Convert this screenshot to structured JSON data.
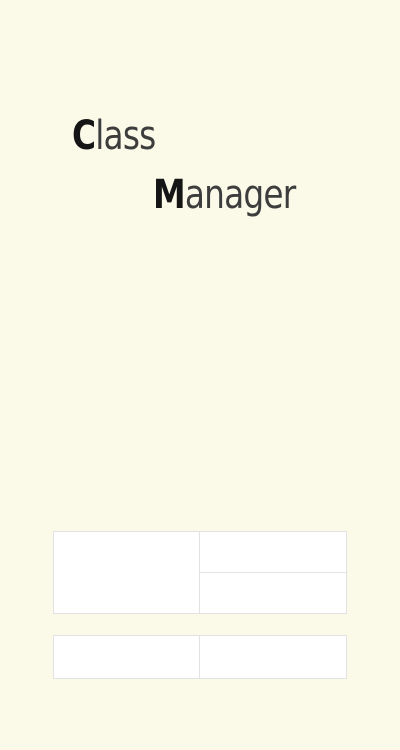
{
  "app_title": {
    "line1_initial": "C",
    "line1_rest": "lass",
    "line2_initial": "M",
    "line2_rest": "anager"
  },
  "colors": {
    "background": "#fbfae9",
    "title_initial": "#151515",
    "title_rest": "#3d3d3d",
    "tile_border": "#e2e2e2",
    "tile_fill": "#ffffff"
  }
}
